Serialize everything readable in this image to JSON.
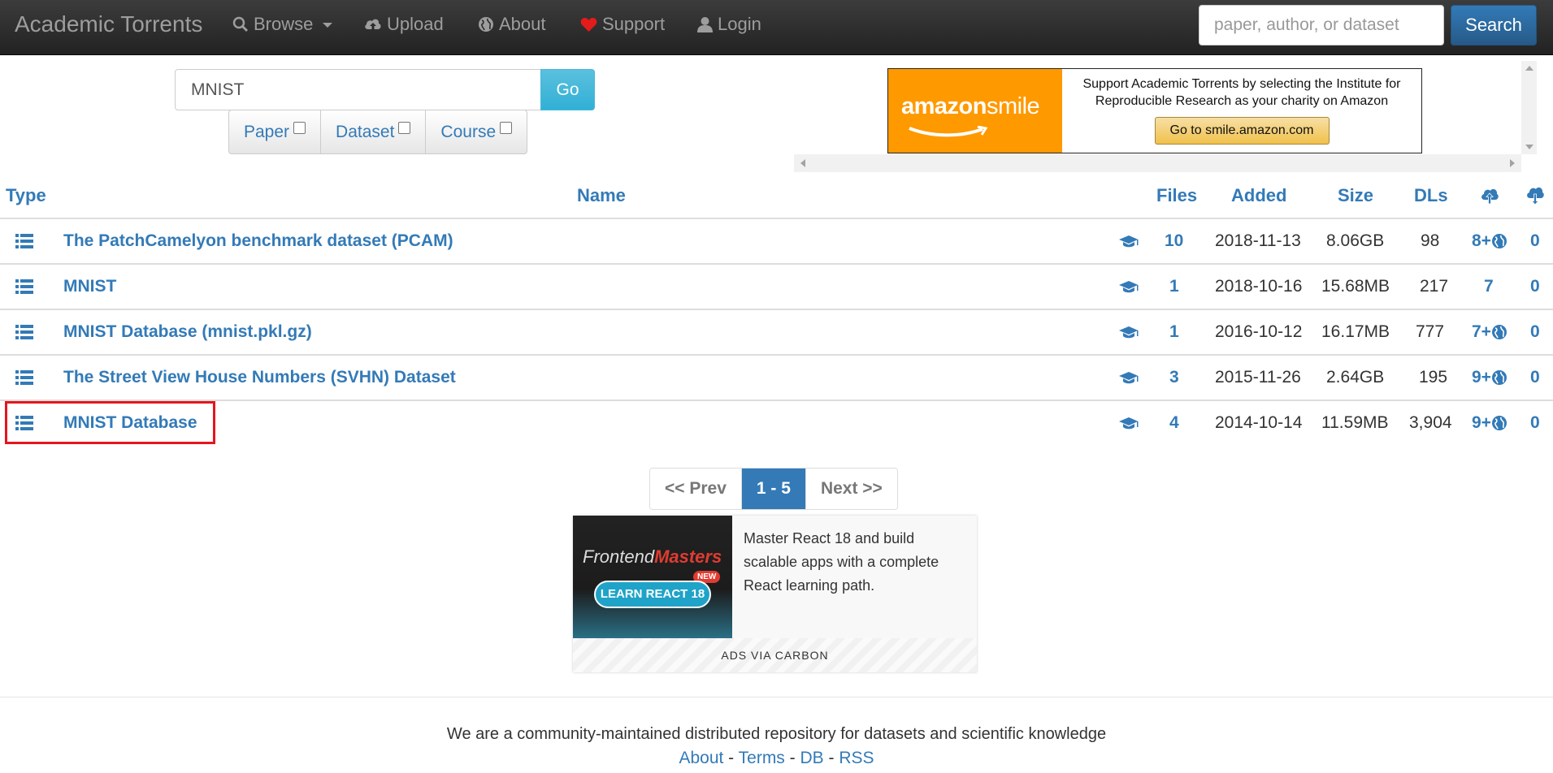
{
  "nav": {
    "brand": "Academic Torrents",
    "browse": "Browse",
    "upload": "Upload",
    "about": "About",
    "support": "Support",
    "login": "Login",
    "search_placeholder": "paper, author, or dataset",
    "search_button": "Search"
  },
  "query": {
    "value": "MNIST",
    "go": "Go",
    "filters": [
      "Paper",
      "Dataset",
      "Course"
    ]
  },
  "amazon_ad": {
    "logo_bold": "amazon",
    "logo_light": "smile",
    "text": "Support Academic Torrents by selecting the Institute for Reproducible Research as your charity on Amazon",
    "button": "Go to smile.amazon.com"
  },
  "table": {
    "headers": {
      "type": "Type",
      "name": "Name",
      "files": "Files",
      "added": "Added",
      "size": "Size",
      "dls": "DLs"
    },
    "rows": [
      {
        "name": "The PatchCamelyon benchmark dataset (PCAM)",
        "files": "10",
        "added": "2018-11-13",
        "size": "8.06GB",
        "dls": "98",
        "seeders": "8+",
        "leechers": "0",
        "web": true
      },
      {
        "name": "MNIST",
        "files": "1",
        "added": "2018-10-16",
        "size": "15.68MB",
        "dls": "217",
        "seeders": "7",
        "leechers": "0",
        "web": false
      },
      {
        "name": "MNIST Database (mnist.pkl.gz)",
        "files": "1",
        "added": "2016-10-12",
        "size": "16.17MB",
        "dls": "777",
        "seeders": "7+",
        "leechers": "0",
        "web": true
      },
      {
        "name": "The Street View House Numbers (SVHN) Dataset",
        "files": "3",
        "added": "2015-11-26",
        "size": "2.64GB",
        "dls": "195",
        "seeders": "9+",
        "leechers": "0",
        "web": true
      },
      {
        "name": "MNIST Database",
        "files": "4",
        "added": "2014-10-14",
        "size": "11.59MB",
        "dls": "3,904",
        "seeders": "9+",
        "leechers": "0",
        "web": true
      }
    ]
  },
  "pagination": {
    "prev": "<< Prev",
    "current": "1 - 5",
    "next": "Next >>"
  },
  "carbon_ad": {
    "img_word1": "Frontend",
    "img_word2": "Masters",
    "img_new": "NEW",
    "img_cta": "LEARN REACT 18",
    "text": "Master React 18 and build scalable apps with a complete React learning path.",
    "footer": "ADS VIA CARBON"
  },
  "footer": {
    "tagline": "We are a community-maintained distributed repository for datasets and scientific knowledge",
    "links": [
      "About",
      "Terms",
      "DB",
      "RSS"
    ],
    "separator": " - "
  },
  "colors": {
    "link": "#337ab7",
    "navbar": "#222222",
    "go_button": "#5bc0de",
    "amazon_orange": "#ff9900",
    "highlight": "#e4161e"
  }
}
